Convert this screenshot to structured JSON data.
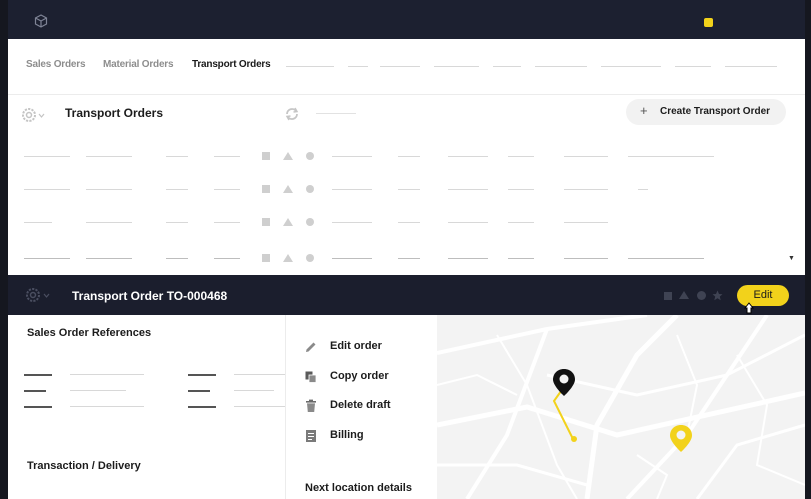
{
  "tabs": [
    {
      "label": "Sales Orders",
      "active": false
    },
    {
      "label": "Material Orders",
      "active": false
    },
    {
      "label": "Transport Orders",
      "active": true
    }
  ],
  "list": {
    "title": "Transport Orders",
    "create_label": "Create Transport Order",
    "create_icon": "+"
  },
  "detail": {
    "title": "Transport Order TO-000468",
    "edit_label": "Edit"
  },
  "left_panel": {
    "sales_order_references": "Sales Order References",
    "transaction_delivery": "Transaction / Delivery"
  },
  "menu": {
    "items": [
      {
        "label": "Edit order",
        "icon": "pencil-icon"
      },
      {
        "label": "Copy order",
        "icon": "copy-icon"
      },
      {
        "label": "Delete draft",
        "icon": "trash-icon"
      },
      {
        "label": "Billing",
        "icon": "billing-icon"
      }
    ],
    "next_location": "Next location details"
  },
  "colors": {
    "accent": "#f2d21b",
    "dark_bar": "#1b1e2d",
    "top_bar": "#1c2030"
  }
}
